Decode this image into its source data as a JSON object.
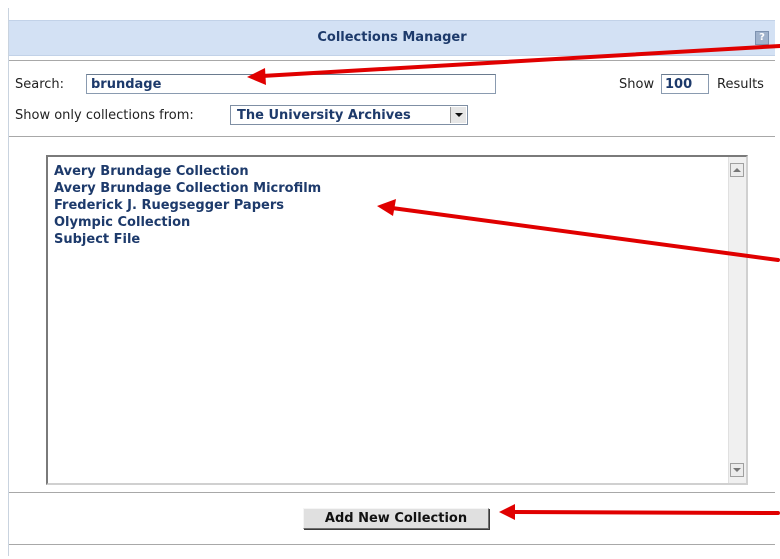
{
  "window": {
    "title": "Collections Manager",
    "help_icon": "help-icon"
  },
  "search": {
    "label": "Search:",
    "value": "brundage"
  },
  "results": {
    "show_label": "Show",
    "count": "100",
    "results_label": "Results"
  },
  "filter": {
    "label": "Show only collections from:",
    "selected": "The University Archives"
  },
  "collections": {
    "items": [
      "Avery Brundage Collection",
      "Avery Brundage Collection Microfilm",
      "Frederick J. Ruegsegger Papers",
      "Olympic Collection",
      "Subject File"
    ]
  },
  "actions": {
    "add_new_label": "Add New Collection"
  },
  "colors": {
    "title_bar": "#d3e1f4",
    "link_text": "#1d3a6b",
    "annotation_arrows": "#e00000"
  }
}
